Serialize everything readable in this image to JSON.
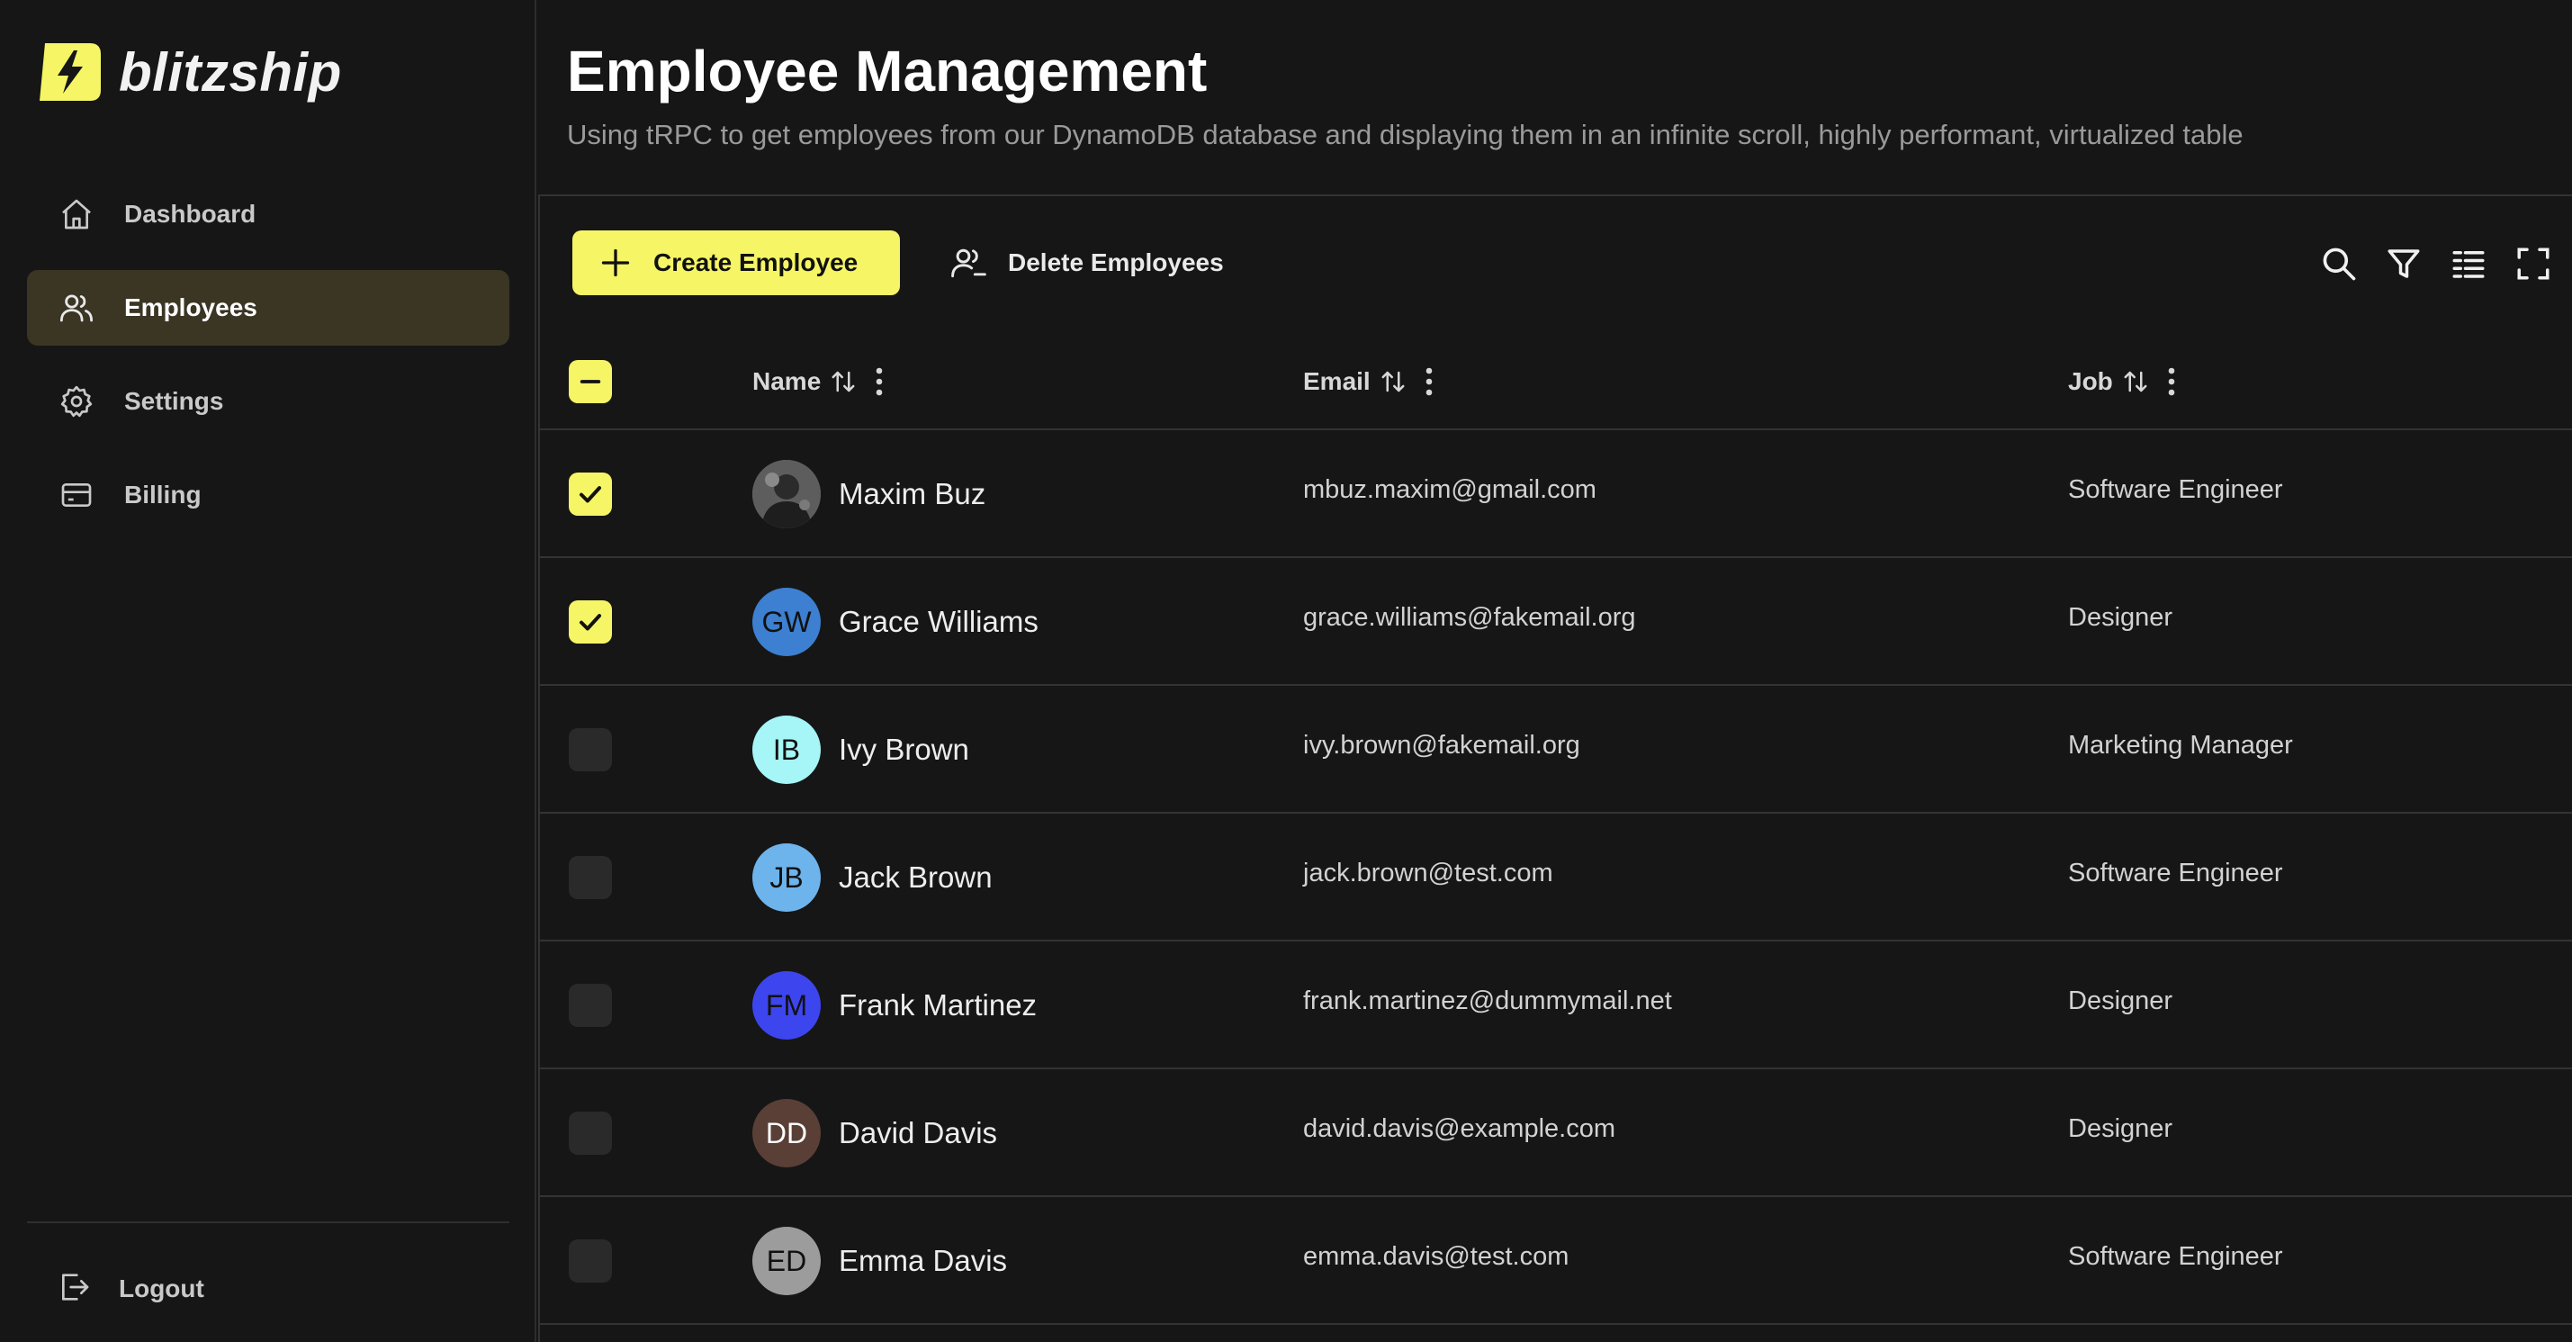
{
  "brand": {
    "name": "blitzship",
    "accent": "#f5f566"
  },
  "sidebar": {
    "items": [
      {
        "label": "Dashboard",
        "icon": "home-icon",
        "active": false
      },
      {
        "label": "Employees",
        "icon": "users-icon",
        "active": true
      },
      {
        "label": "Settings",
        "icon": "gear-icon",
        "active": false
      },
      {
        "label": "Billing",
        "icon": "credit-card-icon",
        "active": false
      }
    ],
    "logout_label": "Logout"
  },
  "page": {
    "title": "Employee Management",
    "subtitle": "Using tRPC to get employees from our DynamoDB database and displaying them in an infinite scroll, highly performant, virtualized table"
  },
  "toolbar": {
    "create_label": "Create Employee",
    "delete_label": "Delete Employees",
    "icons": [
      "search-icon",
      "filter-icon",
      "columns-icon",
      "fullscreen-icon"
    ]
  },
  "table": {
    "columns": {
      "name": "Name",
      "email": "Email",
      "job": "Job"
    },
    "rows": [
      {
        "initials": "",
        "name": "Maxim Buz",
        "email": "mbuz.maxim@gmail.com",
        "job": "Software Engineer",
        "checked": true,
        "avatar_color": "#6b6b6b",
        "photo": true
      },
      {
        "initials": "GW",
        "name": "Grace Williams",
        "email": "grace.williams@fakemail.org",
        "job": "Designer",
        "checked": true,
        "avatar_color": "#3d7fd0"
      },
      {
        "initials": "IB",
        "name": "Ivy Brown",
        "email": "ivy.brown@fakemail.org",
        "job": "Marketing Manager",
        "checked": false,
        "avatar_color": "#a6f5f7"
      },
      {
        "initials": "JB",
        "name": "Jack Brown",
        "email": "jack.brown@test.com",
        "job": "Software Engineer",
        "checked": false,
        "avatar_color": "#6db3ec"
      },
      {
        "initials": "FM",
        "name": "Frank Martinez",
        "email": "frank.martinez@dummymail.net",
        "job": "Designer",
        "checked": false,
        "avatar_color": "#3d45ee"
      },
      {
        "initials": "DD",
        "name": "David Davis",
        "email": "david.davis@example.com",
        "job": "Designer",
        "checked": false,
        "avatar_color": "#5a3f36",
        "light_text": true
      },
      {
        "initials": "ED",
        "name": "Emma Davis",
        "email": "emma.davis@test.com",
        "job": "Software Engineer",
        "checked": false,
        "avatar_color": "#9c9c9c"
      }
    ]
  }
}
